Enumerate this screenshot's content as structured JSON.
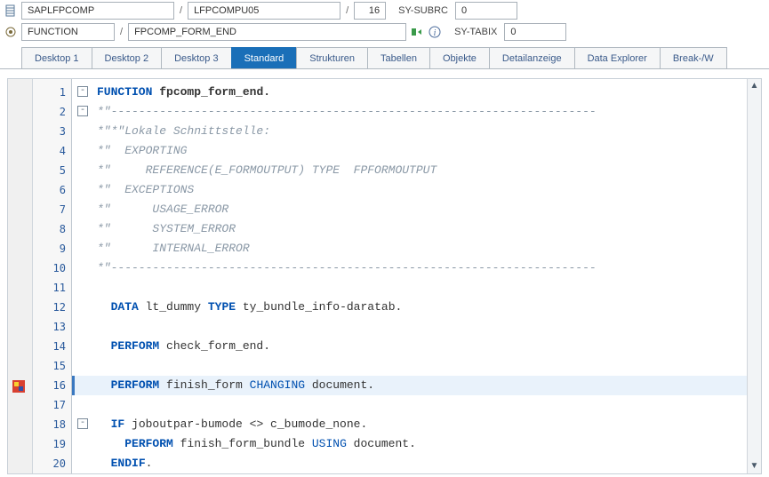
{
  "header": {
    "row1": {
      "program": "SAPLFPCOMP",
      "include": "LFPCOMPU05",
      "line": "16",
      "sy_subrc_label": "SY-SUBRC",
      "sy_subrc": "0"
    },
    "row2": {
      "type": "FUNCTION",
      "name": "FPCOMP_FORM_END",
      "sy_tabix_label": "SY-TABIX",
      "sy_tabix": "0"
    }
  },
  "tabs": [
    {
      "label": "Desktop 1",
      "active": false
    },
    {
      "label": "Desktop 2",
      "active": false
    },
    {
      "label": "Desktop 3",
      "active": false
    },
    {
      "label": "Standard",
      "active": true
    },
    {
      "label": "Strukturen",
      "active": false
    },
    {
      "label": "Tabellen",
      "active": false
    },
    {
      "label": "Objekte",
      "active": false
    },
    {
      "label": "Detailanzeige",
      "active": false
    },
    {
      "label": "Data Explorer",
      "active": false
    },
    {
      "label": "Break-/W",
      "active": false
    }
  ],
  "code": {
    "lines": [
      {
        "n": 1,
        "fold": "-",
        "tokens": [
          {
            "t": "FUNCTION",
            "c": "kw str-fn"
          },
          {
            "t": " fpcomp_form_end.",
            "c": "str-fn"
          }
        ]
      },
      {
        "n": 2,
        "fold": "-",
        "tokens": [
          {
            "t": "*\"----------------------------------------------------------------------",
            "c": "cm"
          }
        ]
      },
      {
        "n": 3,
        "tokens": [
          {
            "t": "*\"*\"Lokale Schnittstelle:",
            "c": "cm"
          }
        ]
      },
      {
        "n": 4,
        "tokens": [
          {
            "t": "*\"  EXPORTING",
            "c": "cm"
          }
        ]
      },
      {
        "n": 5,
        "tokens": [
          {
            "t": "*\"     REFERENCE(E_FORMOUTPUT) TYPE  FPFORMOUTPUT",
            "c": "cm"
          }
        ]
      },
      {
        "n": 6,
        "tokens": [
          {
            "t": "*\"  EXCEPTIONS",
            "c": "cm"
          }
        ]
      },
      {
        "n": 7,
        "tokens": [
          {
            "t": "*\"      USAGE_ERROR",
            "c": "cm"
          }
        ]
      },
      {
        "n": 8,
        "tokens": [
          {
            "t": "*\"      SYSTEM_ERROR",
            "c": "cm"
          }
        ]
      },
      {
        "n": 9,
        "tokens": [
          {
            "t": "*\"      INTERNAL_ERROR",
            "c": "cm"
          }
        ]
      },
      {
        "n": 10,
        "tokens": [
          {
            "t": "*\"----------------------------------------------------------------------",
            "c": "cm"
          }
        ]
      },
      {
        "n": 11,
        "tokens": []
      },
      {
        "n": 12,
        "tokens": [
          {
            "t": "  ",
            "c": ""
          },
          {
            "t": "DATA",
            "c": "kw"
          },
          {
            "t": " lt_dummy ",
            "c": "id"
          },
          {
            "t": "TYPE",
            "c": "kw"
          },
          {
            "t": " ty_bundle_info-daratab.",
            "c": "id"
          }
        ]
      },
      {
        "n": 13,
        "tokens": []
      },
      {
        "n": 14,
        "tokens": [
          {
            "t": "  ",
            "c": ""
          },
          {
            "t": "PERFORM",
            "c": "kw"
          },
          {
            "t": " check_form_end.",
            "c": "id"
          }
        ]
      },
      {
        "n": 15,
        "tokens": []
      },
      {
        "n": 16,
        "hl": true,
        "tokens": [
          {
            "t": "  ",
            "c": ""
          },
          {
            "t": "PERFORM",
            "c": "kw"
          },
          {
            "t": " finish_form ",
            "c": "id"
          },
          {
            "t": "CHANGING",
            "c": "kw-nb"
          },
          {
            "t": " document.",
            "c": "id"
          }
        ]
      },
      {
        "n": 17,
        "tokens": []
      },
      {
        "n": 18,
        "fold": "-",
        "tokens": [
          {
            "t": "  ",
            "c": ""
          },
          {
            "t": "IF",
            "c": "kw"
          },
          {
            "t": " joboutpar-bumode <> c_bumode_none.",
            "c": "id"
          }
        ]
      },
      {
        "n": 19,
        "tokens": [
          {
            "t": "    ",
            "c": ""
          },
          {
            "t": "PERFORM",
            "c": "kw"
          },
          {
            "t": " finish_form_bundle ",
            "c": "id"
          },
          {
            "t": "USING",
            "c": "kw-nb"
          },
          {
            "t": " document.",
            "c": "id"
          }
        ]
      },
      {
        "n": 20,
        "tokens": [
          {
            "t": "  ",
            "c": ""
          },
          {
            "t": "ENDIF",
            "c": "kw"
          },
          {
            "t": ".",
            "c": "id"
          }
        ]
      }
    ]
  }
}
